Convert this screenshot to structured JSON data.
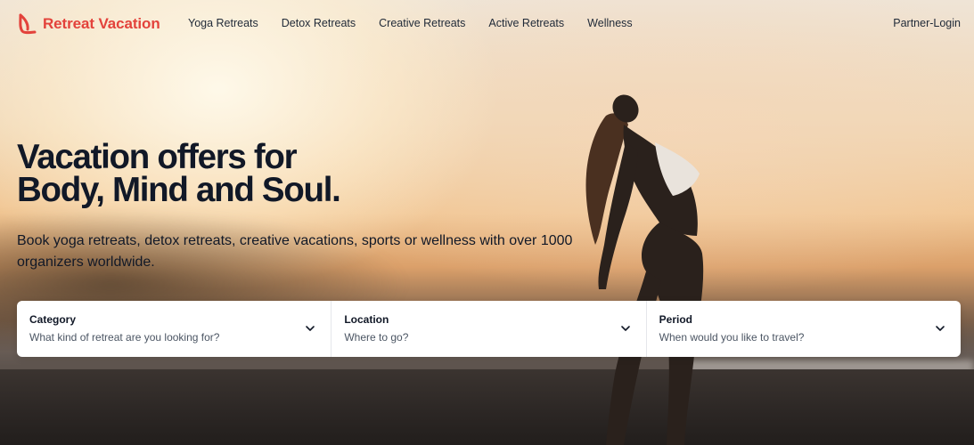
{
  "brand": {
    "name": "Retreat Vacation",
    "color": "#e3423b"
  },
  "nav": {
    "items": [
      {
        "label": "Yoga Retreats"
      },
      {
        "label": "Detox Retreats"
      },
      {
        "label": "Creative Retreats"
      },
      {
        "label": "Active Retreats"
      },
      {
        "label": "Wellness"
      }
    ],
    "partner_login": "Partner-Login"
  },
  "hero": {
    "headline_line1": "Vacation offers for",
    "headline_line2": "Body, Mind and Soul.",
    "subtitle": "Book yoga retreats, detox retreats, creative vacations, sports or wellness with over 1000 organizers worldwide.",
    "background_image": "woman stretching backwards on a beach at sunset"
  },
  "search": {
    "fields": [
      {
        "label": "Category",
        "value": "What kind of retreat are you looking for?",
        "icon": "chevron-down-icon"
      },
      {
        "label": "Location",
        "value": "Where to go?",
        "icon": "chevron-down-icon"
      },
      {
        "label": "Period",
        "value": "When would you like to travel?",
        "icon": "chevron-down-icon"
      }
    ]
  }
}
